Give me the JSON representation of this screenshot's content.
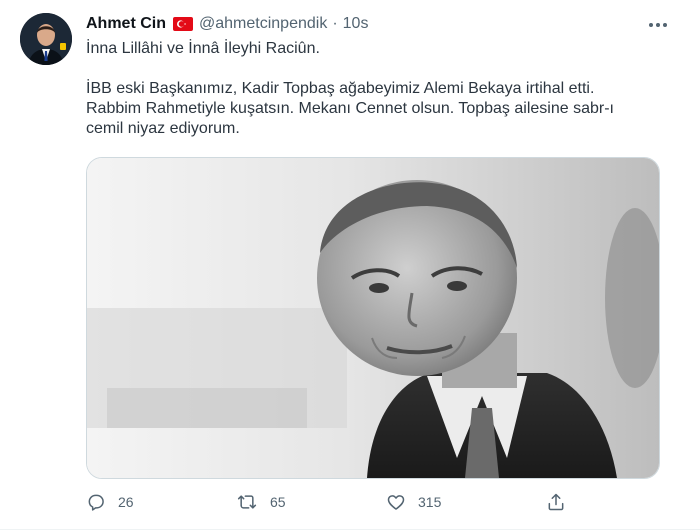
{
  "tweet": {
    "author_name": "Ahmet Cin",
    "handle": "@ahmetcinpendik",
    "separator": "·",
    "time": "10s",
    "text_line1": "İnna Lillâhi ve İnnâ İleyhi Raciûn.",
    "text_line2": "İBB eski Başkanımız, Kadir Topbaş ağabeyimiz Alemi Bekaya irtihal etti.",
    "text_line3": "Rabbim Rahmetiyle kuşatsın. Mekanı Cennet olsun. Topbaş ailesine sabr-ı",
    "text_line4": "cemil niyaz ediyorum."
  },
  "actions": {
    "replies": "26",
    "retweets": "65",
    "likes": "315"
  },
  "icons": {
    "flag": "turkey-flag-icon",
    "more": "more-icon",
    "reply": "reply-icon",
    "retweet": "retweet-icon",
    "like": "like-icon",
    "share": "share-icon"
  },
  "colors": {
    "text": "#0f1419",
    "secondary": "#536471",
    "flag_red": "#e30a17"
  }
}
